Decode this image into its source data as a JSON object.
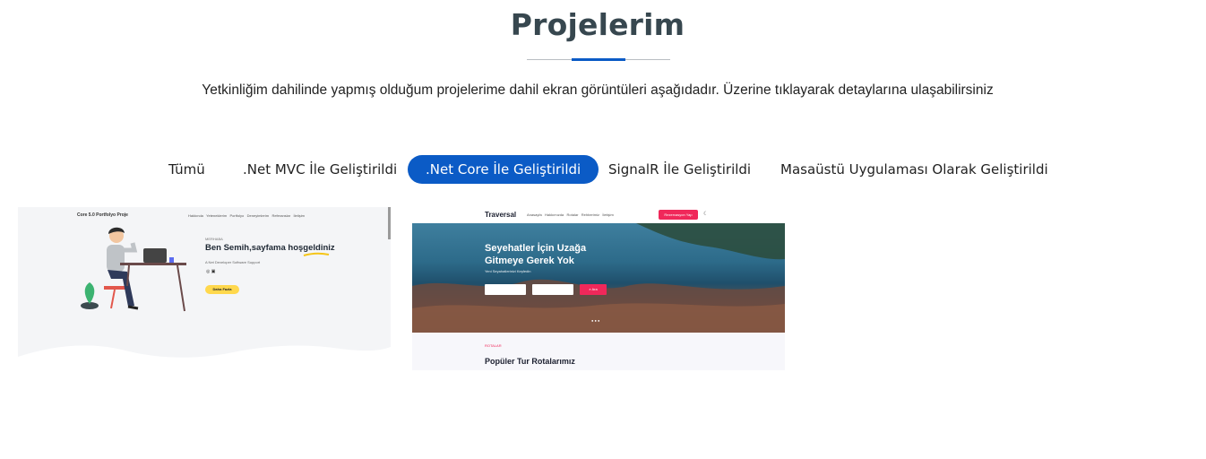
{
  "section": {
    "title": "Projelerim",
    "subtitle": "Yetkinliğim dahilinde yapmış olduğum projelerime dahil ekran görüntüleri aşağıdadır. Üzerine tıklayarak detaylarına ulaşabilirsiniz"
  },
  "filters": [
    {
      "label": "Tümü",
      "active": false
    },
    {
      "label": ".Net MVC İle Geliştirildi",
      "active": false
    },
    {
      "label": ".Net Core İle Geliştirildi",
      "active": true
    },
    {
      "label": "SignalR İle Geliştirildi",
      "active": false
    },
    {
      "label": "Masaüstü Uygulaması Olarak Geliştirildi",
      "active": false
    }
  ],
  "projects": [
    {
      "brand": "Core 5.0 Portfolyo Proje",
      "nav": [
        "Hakkında",
        "Yeteneklerim",
        "Portfolyo",
        "Deneyimlerim",
        "Referanslar",
        "İletişim"
      ],
      "small_heading": "MERHABA",
      "headline": "Ben Semih,sayfama hoşgeldiniz",
      "role": "A Net Developer Software Support",
      "cta": "Daha Fazla"
    },
    {
      "brand": "Traversal",
      "nav": [
        "Anasayfa",
        "Hakkımızda",
        "Rotalar",
        "Rehberimiz",
        "İletişim"
      ],
      "nav_button": "Rezervasyon Yap",
      "hero_title_1": "Seyehatler İçin Uzağa",
      "hero_title_2": "Gitmeye Gerek Yok",
      "hero_sub": "Yeni Seyahatlerinizi Keşfedin",
      "search_button": "Ara",
      "section_tag": "ROTALAR",
      "section_title": "Popüler Tur Rotalarımız"
    }
  ],
  "colors": {
    "accent": "#0b5bc6",
    "title": "#37474f",
    "cta_yellow": "#ffd84d",
    "traversal_pink": "#f0285a"
  }
}
